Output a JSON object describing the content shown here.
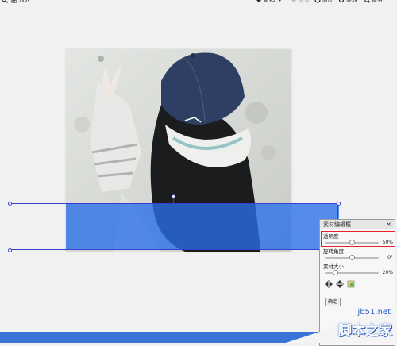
{
  "toolbar": {
    "left": [
      {
        "icon": "zoom-icon",
        "label": ""
      },
      {
        "icon": "enlarge-icon",
        "label": "放大"
      }
    ],
    "right": [
      {
        "icon": "undo-icon",
        "label": "撤销",
        "dropdown": true
      },
      {
        "icon": "redo-icon",
        "label": "重做",
        "disabled": true
      },
      {
        "icon": "original-icon",
        "label": "原图"
      },
      {
        "icon": "rotate-icon",
        "label": "旋转"
      },
      {
        "icon": "crop-icon",
        "label": "裁剪"
      }
    ]
  },
  "panel": {
    "title": "素材编辑框",
    "close": "×",
    "opacity": {
      "label": "透明度",
      "value": "50%",
      "level": 0.5
    },
    "rotation": {
      "label": "旋转角度",
      "value": "0°",
      "level": 0.5
    },
    "size": {
      "label": "素材大小",
      "value": "20%",
      "level": 0.2
    },
    "button_label": "确定"
  },
  "colors": {
    "overlay": "#2a6eeb",
    "selection": "#3b3fd0",
    "highlight": "#e8202a",
    "bottom_bar": "#3a73d6"
  },
  "watermark": {
    "site": "jb51.net",
    "brand": "脚本之家"
  }
}
